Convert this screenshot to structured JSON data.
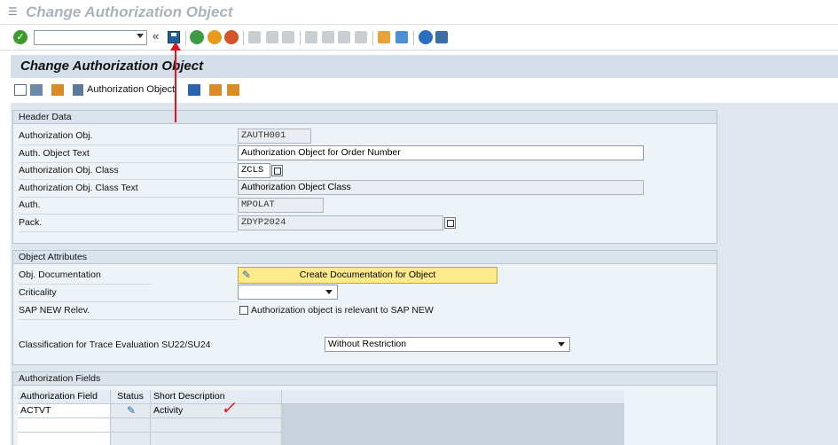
{
  "title": "Change Authorization Object",
  "screen_title": "Change Authorization Object",
  "toolbar": {
    "auth_object_button": "Authorization Object"
  },
  "header_data": {
    "group_title": "Header Data",
    "auth_obj_label": "Authorization Obj.",
    "auth_obj_value": "ZAUTH001",
    "auth_text_label": "Auth. Object Text",
    "auth_text_value": "Authorization Object for Order Number",
    "class_label": "Authorization Obj. Class",
    "class_value": "ZCLS",
    "class_text_label": "Authorization Obj. Class Text",
    "class_text_value": "Authorization Object Class",
    "auth_label": "Auth.",
    "auth_value": "MPOLAT",
    "pack_label": "Pack.",
    "pack_value": "ZDYP2024"
  },
  "object_attributes": {
    "group_title": "Object Attributes",
    "doc_label": "Obj. Documentation",
    "doc_button": "Create Documentation for Object",
    "criticality_label": "Criticality",
    "criticality_value": "",
    "sap_new_label": "SAP NEW Relev.",
    "sap_new_checkbox": "Authorization object is relevant to SAP NEW",
    "trace_label": "Classification for Trace Evaluation SU22/SU24",
    "trace_value": "Without Restriction"
  },
  "auth_fields": {
    "group_title": "Authorization Fields",
    "columns": [
      "Authorization Field",
      "Status",
      "Short Description"
    ],
    "rows": [
      {
        "field": "ACTVT",
        "status_icon": "pencil-icon",
        "description": "Activity"
      }
    ]
  },
  "colors": {
    "annotation": "#e0141e",
    "doc_button": "#fdeb8b"
  }
}
